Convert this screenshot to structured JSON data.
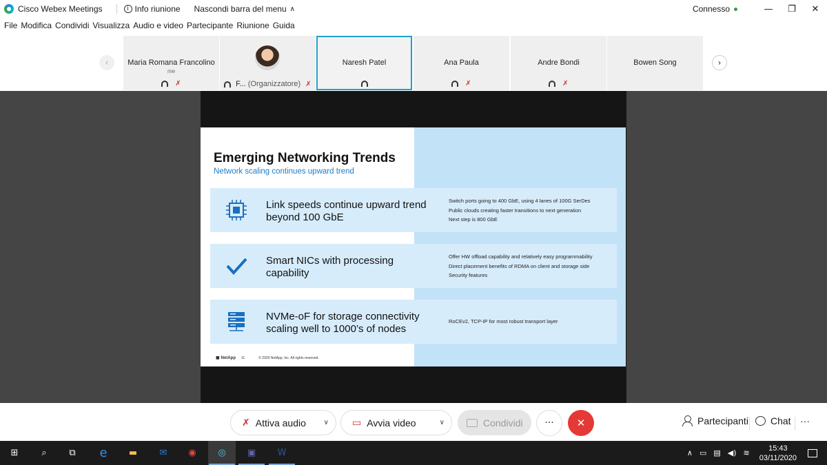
{
  "window": {
    "app_title": "Cisco Webex Meetings",
    "info_label": "Info riunione",
    "hide_menu_label": "Nascondi barra del menu",
    "status": "Connesso"
  },
  "menu": [
    "File",
    "Modifica",
    "Condividi",
    "Visualizza",
    "Audio e video",
    "Partecipante",
    "Riunione",
    "Guida"
  ],
  "participants": [
    {
      "name": "Maria Romana Francolino",
      "sub": "me"
    },
    {
      "name": "F...",
      "role": "(Organizzatore)"
    },
    {
      "name": "Naresh Patel",
      "active": true
    },
    {
      "name": "Ana Paula"
    },
    {
      "name": "Andre Bondi"
    },
    {
      "name": "Bowen Song"
    }
  ],
  "slide": {
    "title": "Emerging Networking Trends",
    "subtitle": "Network scaling continues upward trend",
    "items": [
      {
        "icon": "chip-icon",
        "main_line1": "Link speeds continue upward trend",
        "main_line2": "beyond 100 GbE",
        "details": [
          "Switch ports going to 400 GbE, using 4 lanes of 100G SerDes",
          "Public clouds creating faster transitions to next generation",
          "Next step is 800 GbE"
        ]
      },
      {
        "icon": "checkmark-icon",
        "main_line1": "Smart NICs with processing",
        "main_line2": "capability",
        "details": [
          "Offer HW offload capability and relatively easy programmability",
          "Direct placement benefits of RDMA on client and storage side",
          "Security features"
        ]
      },
      {
        "icon": "server-icon",
        "main_line1": "NVMe-oF for storage connectivity",
        "main_line2": "scaling well to 1000’s of nodes",
        "details": [
          "RoCEv2, TCP-IP for most robust transport layer"
        ]
      }
    ],
    "footer_logo": "NetApp",
    "page_number": "11",
    "copyright": "© 2020 NetApp, Inc. All rights reserved."
  },
  "controls": {
    "audio_label": "Attiva audio",
    "video_label": "Avvia video",
    "share_label": "Condividi",
    "participants_label": "Partecipanti",
    "chat_label": "Chat"
  },
  "taskbar": {
    "time": "15:43",
    "date": "03/11/2020"
  },
  "colors": {
    "accent": "#1da1c9",
    "end_call": "#e53935",
    "slide_blue": "#1f7bc4"
  }
}
